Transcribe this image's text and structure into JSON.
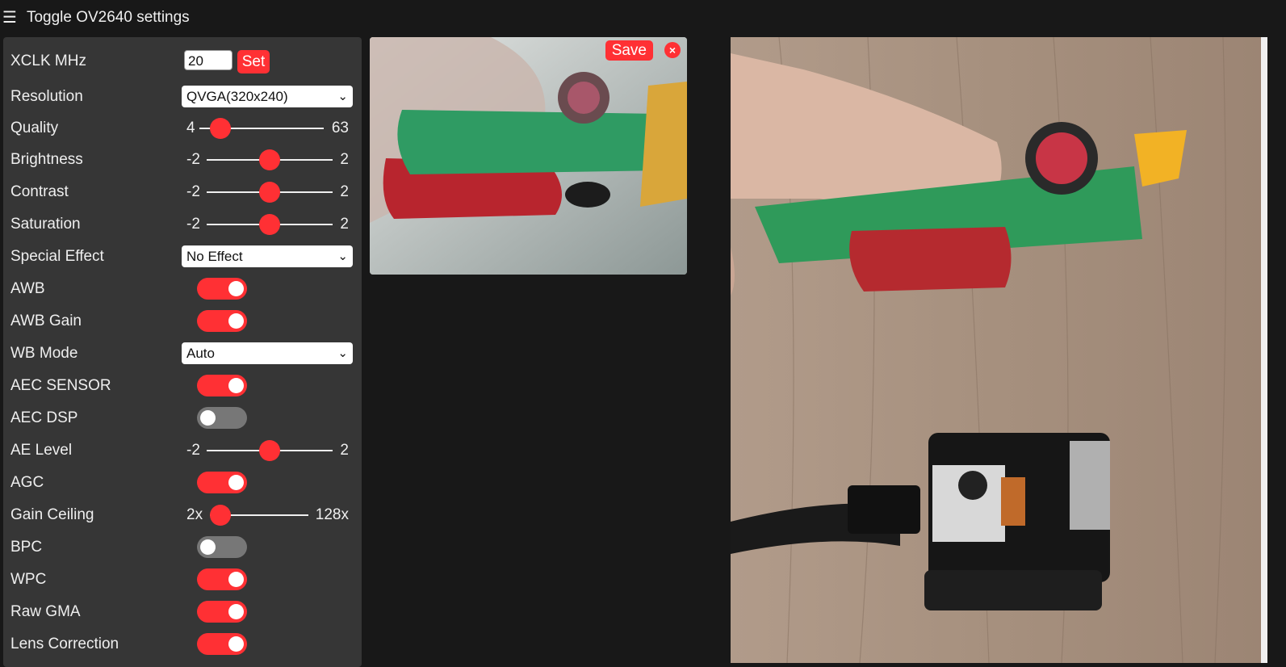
{
  "header": {
    "menu_icon": "☰",
    "title": "Toggle OV2640 settings"
  },
  "settings": {
    "xclk": {
      "label": "XCLK MHz",
      "value": "20",
      "button": "Set"
    },
    "resolution": {
      "label": "Resolution",
      "value": "QVGA(320x240)"
    },
    "quality": {
      "label": "Quality",
      "min": "4",
      "max": "63",
      "value": 10
    },
    "brightness": {
      "label": "Brightness",
      "min": "-2",
      "max": "2",
      "value": 0
    },
    "contrast": {
      "label": "Contrast",
      "min": "-2",
      "max": "2",
      "value": 0
    },
    "saturation": {
      "label": "Saturation",
      "min": "-2",
      "max": "2",
      "value": 0
    },
    "special_effect": {
      "label": "Special Effect",
      "value": "No Effect"
    },
    "awb": {
      "label": "AWB",
      "on": true
    },
    "awb_gain": {
      "label": "AWB Gain",
      "on": true
    },
    "wb_mode": {
      "label": "WB Mode",
      "value": "Auto"
    },
    "aec_sensor": {
      "label": "AEC SENSOR",
      "on": true
    },
    "aec_dsp": {
      "label": "AEC DSP",
      "on": false
    },
    "ae_level": {
      "label": "AE Level",
      "min": "-2",
      "max": "2",
      "value": 0
    },
    "agc": {
      "label": "AGC",
      "on": true
    },
    "gain_ceiling": {
      "label": "Gain Ceiling",
      "min": "2x",
      "max": "128x",
      "value": 0
    },
    "bpc": {
      "label": "BPC",
      "on": false
    },
    "wpc": {
      "label": "WPC",
      "on": true
    },
    "raw_gma": {
      "label": "Raw GMA",
      "on": true
    },
    "lens_correction": {
      "label": "Lens Correction",
      "on": true
    }
  },
  "stream": {
    "save_label": "Save",
    "close_label": "×"
  },
  "colors": {
    "accent": "#ff3034",
    "panel": "#363636",
    "background": "#181818",
    "toggle_off": "#777777"
  }
}
